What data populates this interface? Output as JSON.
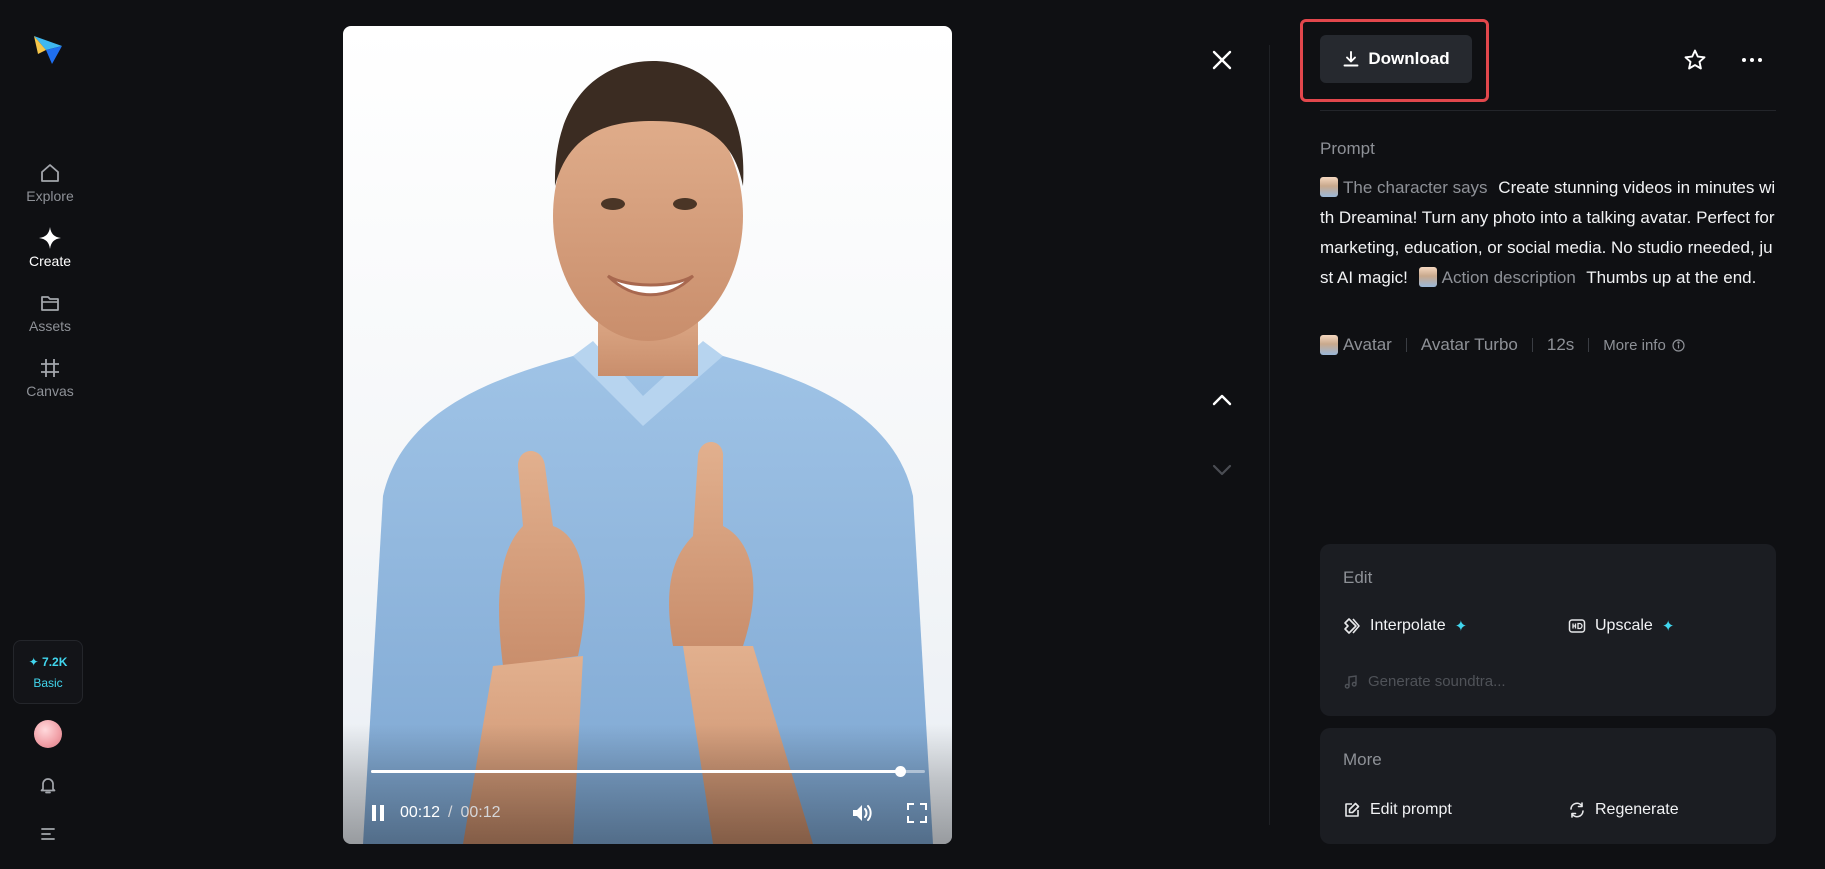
{
  "sidebar": {
    "nav": [
      {
        "label": "Explore",
        "icon": "home-icon",
        "active": false
      },
      {
        "label": "Create",
        "icon": "sparkle-icon",
        "active": true
      },
      {
        "label": "Assets",
        "icon": "folder-icon",
        "active": false
      },
      {
        "label": "Canvas",
        "icon": "frame-icon",
        "active": false
      }
    ],
    "credits": {
      "value": "✦ 7.2K",
      "plan": "Basic"
    }
  },
  "player": {
    "current_time": "00:12",
    "separator": "/",
    "total_time": "00:12",
    "progress": 0.955
  },
  "toolbar": {
    "download_label": "Download"
  },
  "prompt": {
    "heading": "Prompt",
    "speech_chip": "The character says",
    "speech_text": "Create stunning videos in minutes with Dreamina! Turn any photo into a talking avatar. Perfect for marketing, education, or social media. No studio rneeded, just AI magic!",
    "action_chip": "Action description",
    "action_text": "Thumbs up at the end."
  },
  "meta": {
    "type": "Avatar",
    "model": "Avatar Turbo",
    "duration": "12s",
    "more_info": "More info"
  },
  "edit_card": {
    "title": "Edit",
    "interpolate": "Interpolate",
    "upscale": "Upscale",
    "soundtrack": "Generate soundtra..."
  },
  "more_card": {
    "title": "More",
    "edit_prompt": "Edit prompt",
    "regenerate": "Regenerate"
  },
  "colors": {
    "accent": "#41d6ee",
    "highlight": "#e2474c",
    "background": "#0f1013",
    "card": "#1b1d22"
  }
}
